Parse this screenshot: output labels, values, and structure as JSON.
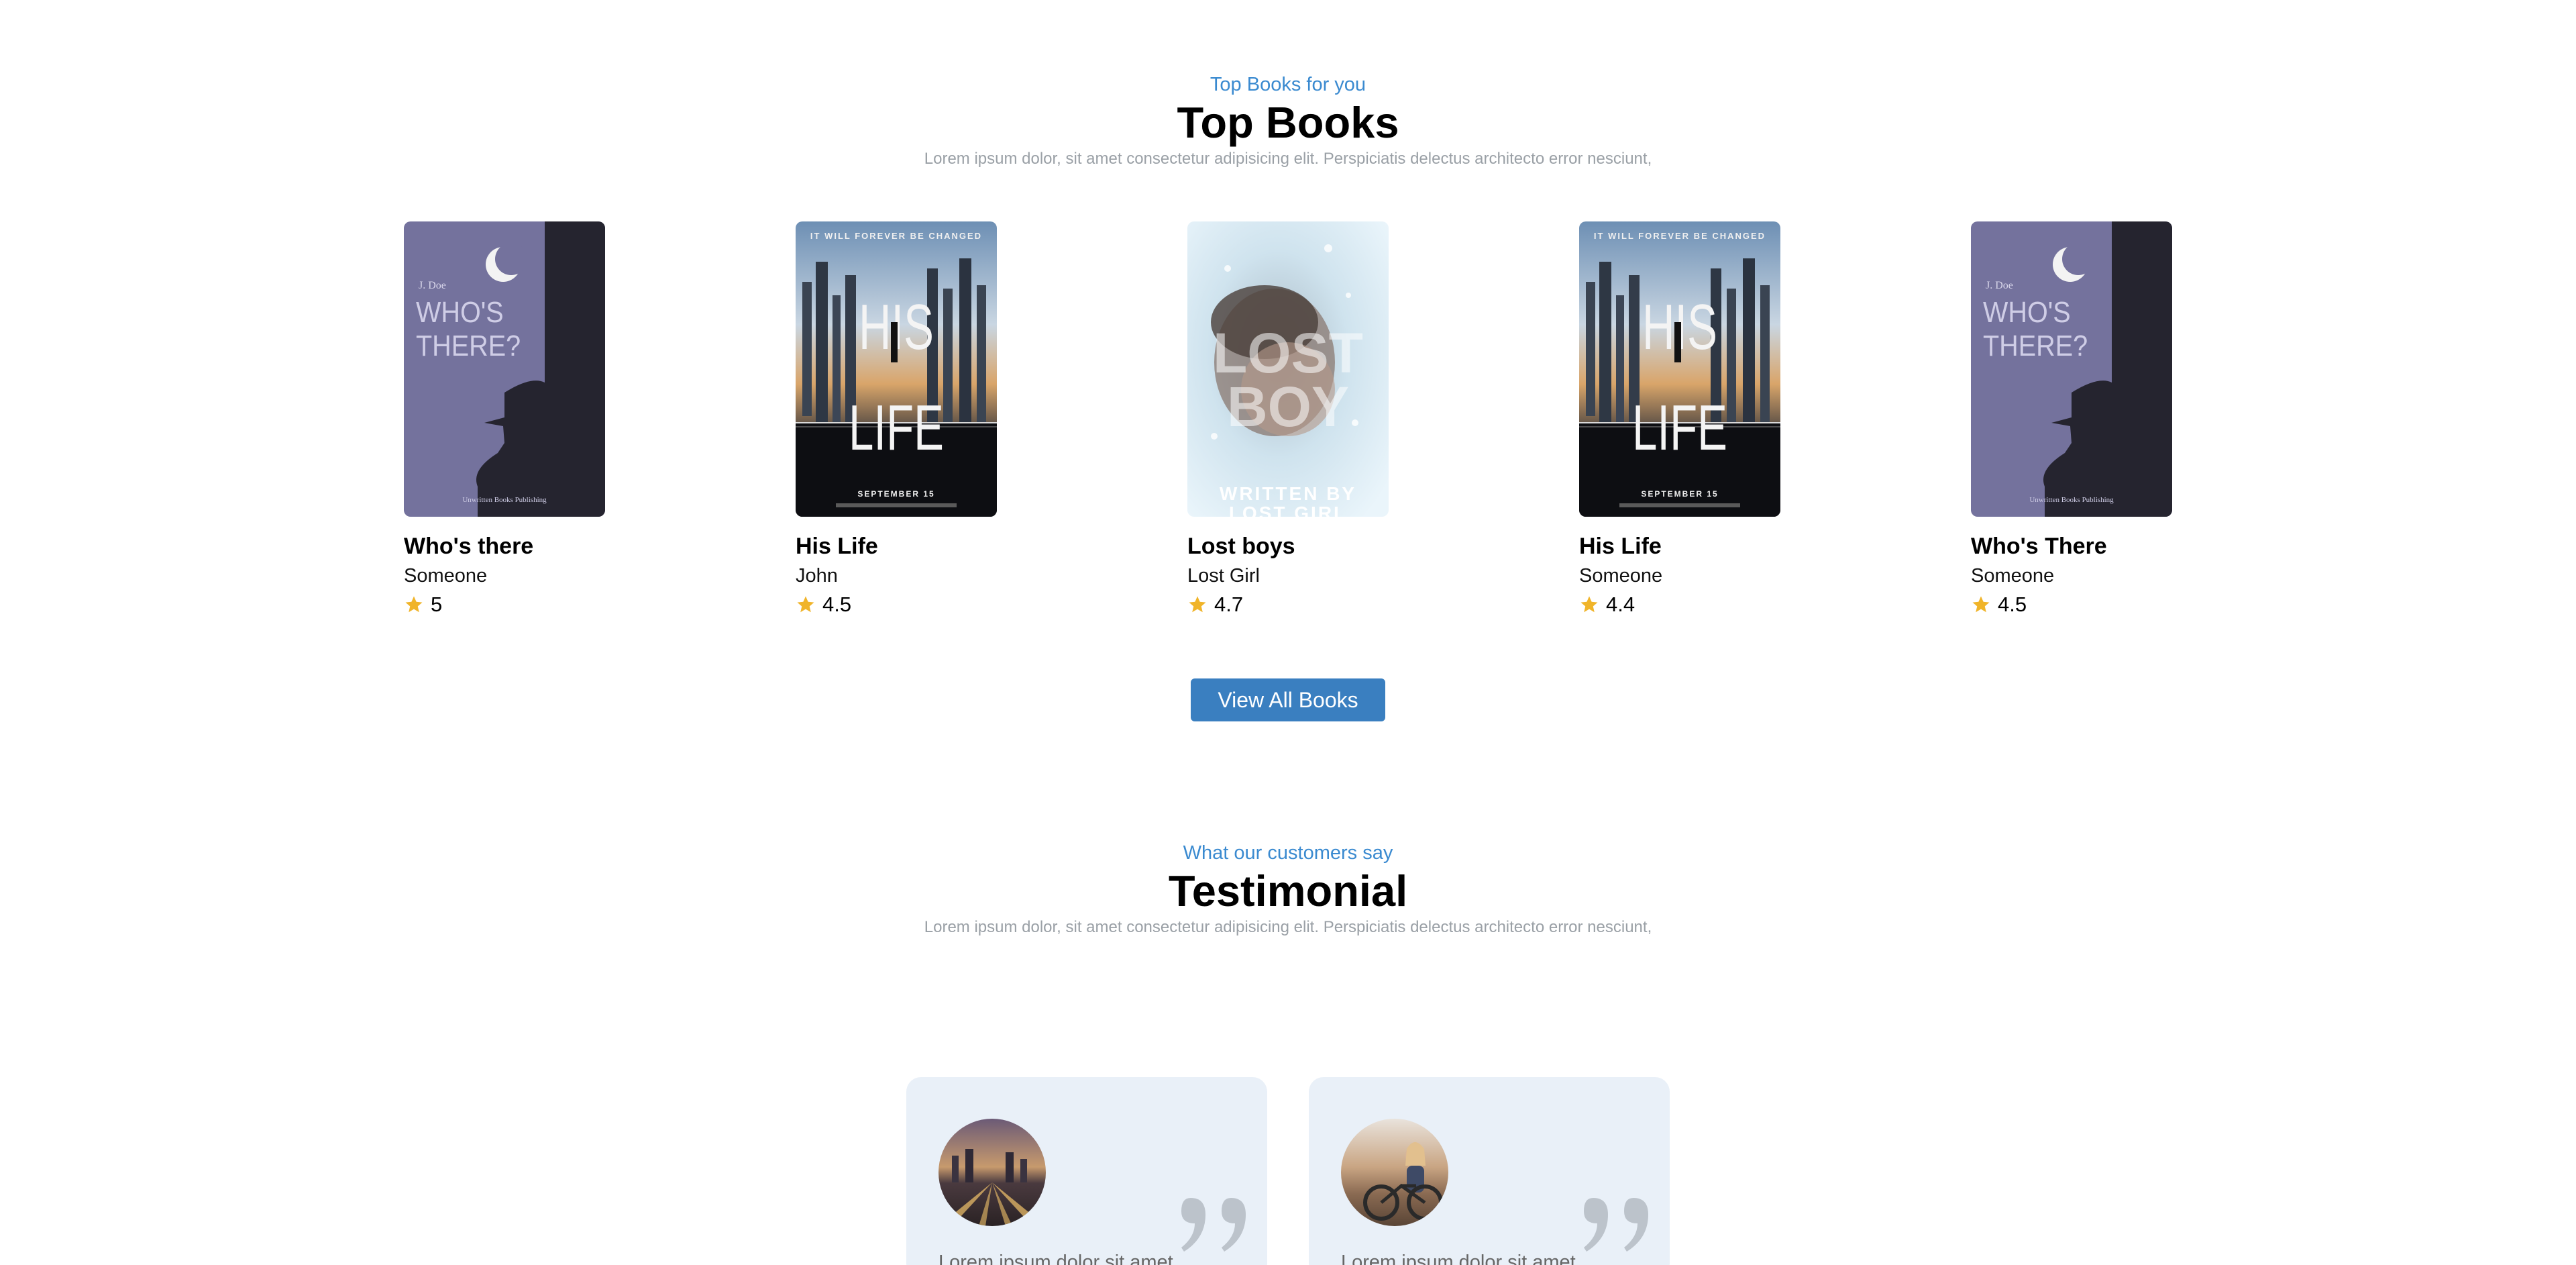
{
  "top_books": {
    "eyebrow": "Top Books for you",
    "title": "Top Books",
    "subtitle": "Lorem ipsum dolor, sit amet consectetur adipisicing elit. Perspiciatis delectus architecto error nesciunt,",
    "books": [
      {
        "title": "Who's there",
        "author": "Someone",
        "rating": "5",
        "cover": "whos-there"
      },
      {
        "title": "His Life",
        "author": "John",
        "rating": "4.5",
        "cover": "his-life"
      },
      {
        "title": "Lost boys",
        "author": "Lost Girl",
        "rating": "4.7",
        "cover": "lost-boy"
      },
      {
        "title": "His Life",
        "author": "Someone",
        "rating": "4.4",
        "cover": "his-life"
      },
      {
        "title": "Who's There",
        "author": "Someone",
        "rating": "4.5",
        "cover": "whos-there"
      }
    ],
    "view_all_label": "View All Books"
  },
  "covers": {
    "whos_there": {
      "author": "J. Doe",
      "title_line1": "WHO'S",
      "title_line2": "THERE?",
      "publisher": "Unwritten Books Publishing"
    },
    "his_life": {
      "tagline": "IT WILL FOREVER BE CHANGED",
      "title_line1": "HIS",
      "title_line2": "LIFE",
      "date": "SEPTEMBER 15"
    },
    "lost_boy": {
      "title_line1": "LOST",
      "title_line2": "BOY",
      "byline1": "WRITTEN BY",
      "byline2": "LOST GIRL"
    }
  },
  "testimonial": {
    "eyebrow": "What our customers say",
    "title": "Testimonial",
    "subtitle": "Lorem ipsum dolor, sit amet consectetur adipisicing elit. Perspiciatis delectus architecto error nesciunt,",
    "cards": [
      {
        "text": "Lorem ipsum dolor sit amet",
        "avatar": "city-night"
      },
      {
        "text": "Lorem ipsum dolor sit amet",
        "avatar": "cyclist"
      }
    ]
  },
  "colors": {
    "accent": "#3a8ad0",
    "button": "#3a7fc0",
    "star": "#f0b429",
    "card_bg": "#e9f0f8"
  },
  "icons": {
    "rating": "star-icon",
    "quote": "quote-icon"
  }
}
